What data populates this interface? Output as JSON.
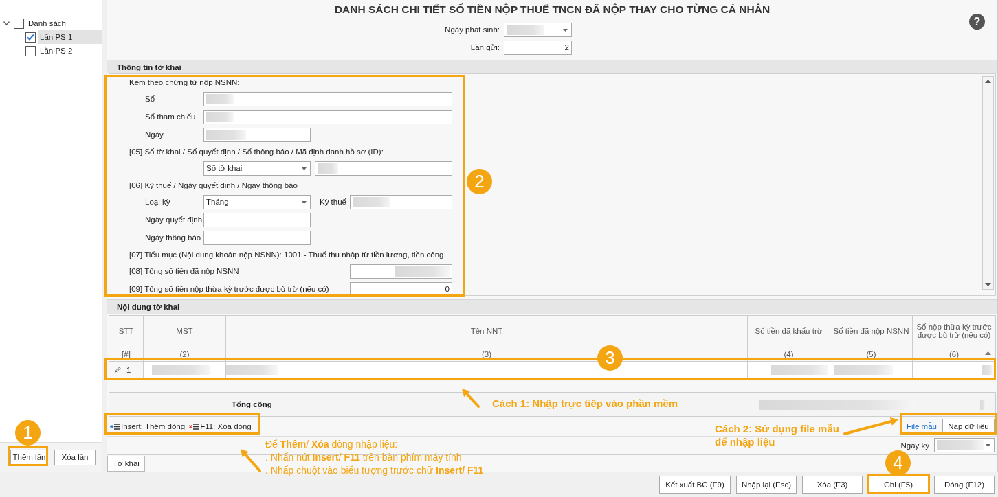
{
  "sidebar": {
    "tree": [
      {
        "label": "Danh sách",
        "checked": false,
        "expanded": true,
        "selected": false,
        "children": [
          {
            "label": "Lần PS 1",
            "checked": true,
            "selected": true
          },
          {
            "label": "Lần PS 2",
            "checked": false,
            "selected": false
          }
        ]
      }
    ],
    "buttons": [
      "Thêm lần",
      "Xóa lần"
    ]
  },
  "title": "DANH SÁCH CHI TIẾT SỐ TIỀN NỘP THUẾ TNCN ĐÃ NỘP THAY CHO TỪNG CÁ NHÂN",
  "help_button": "?",
  "header_fields": [
    {
      "label": "Ngày phát sinh:",
      "kind": "dropdown",
      "redacted": true
    },
    {
      "label": "Lần gửi:",
      "kind": "number",
      "value": "2"
    }
  ],
  "info_section": {
    "title": "Thông tin tờ khai",
    "rows": [
      {
        "kind": "heading",
        "label": "Kèm theo chứng từ nộp NSNN:"
      },
      {
        "kind": "text",
        "label": "Số",
        "redacted": true
      },
      {
        "kind": "text",
        "label": "Số tham chiếu",
        "redacted": true
      },
      {
        "kind": "date",
        "label": "Ngày",
        "redacted": true
      },
      {
        "kind": "heading",
        "label": "[05] Số tờ khai / Số quyết định / Số thông báo / Mã định danh hồ sơ (ID):"
      },
      {
        "kind": "select_text",
        "select": "Số tờ khai",
        "redacted": true
      },
      {
        "kind": "heading",
        "label": "[06] Kỳ thuế / Ngày quyết định / Ngày thông báo"
      },
      {
        "kind": "select_period",
        "label": "Loại kỳ",
        "select": "Tháng",
        "label2": "Kỳ thuế",
        "redacted": true
      },
      {
        "kind": "date",
        "label": "Ngày quyết định",
        "redacted": false
      },
      {
        "kind": "date",
        "label": "Ngày thông báo",
        "redacted": false
      },
      {
        "kind": "heading",
        "label": "[07] Tiểu mục (Nội dung khoản nộp NSNN): 1001 - Thuế thu nhập từ tiền lương, tiền công"
      },
      {
        "kind": "amount",
        "label": "[08] Tổng số tiền đã nộp NSNN",
        "redacted": true
      },
      {
        "kind": "amount",
        "label": "[09] Tổng số tiền nộp thừa kỳ trước được bù trừ (nếu có)",
        "value": "0",
        "redacted": false
      }
    ]
  },
  "content_section": {
    "title": "Nội dung tờ khai",
    "columns": [
      {
        "label": "STT",
        "number": "[#]"
      },
      {
        "label": "MST",
        "number": "(2)"
      },
      {
        "label": "Tên NNT",
        "number": "(3)"
      },
      {
        "label": "Số tiền đã khấu trừ",
        "number": "(4)"
      },
      {
        "label": "Số tiền đã nộp NSNN",
        "number": "(5)"
      },
      {
        "label": "Số nộp thừa kỳ trước được bù trừ (nếu có)",
        "number": "(6)"
      }
    ],
    "rows": [
      {
        "stt": "1",
        "editing": true,
        "cells": [
          {
            "redacted": true
          },
          {
            "redacted": true
          },
          {
            "redacted": true
          },
          {
            "redacted": true
          },
          {
            "redacted": true
          }
        ]
      }
    ],
    "total": {
      "label": "Tổng cộng",
      "redacted": true
    },
    "toolbar": [
      {
        "kind": "insert",
        "label": "Insert: Thêm dòng"
      },
      {
        "kind": "delete",
        "label": "F11: Xóa dòng"
      }
    ],
    "template_link": "File mẫu",
    "load_button": "Nạp dữ liệu",
    "sign_date": {
      "label": "Ngày ký",
      "redacted": true
    }
  },
  "tabs": [
    {
      "label": "Tờ khai",
      "selected": true
    }
  ],
  "footer_buttons": [
    "Kết xuất BC (F9)",
    "Nhập lại (Esc)",
    "Xóa (F3)",
    "Ghi (F5)",
    "Đóng (F12)"
  ],
  "annotations": {
    "badges": [
      "1",
      "2",
      "3",
      "4"
    ],
    "notes": [
      {
        "kind": "single",
        "lines": [
          "Cách 1: Nhập trực tiếp vào phần mềm"
        ]
      },
      {
        "kind": "single",
        "lines": [
          "Cách 2: Sử dụng file mẫu",
          "để nhập liệu"
        ]
      },
      {
        "kind": "detail",
        "lines": [
          "Để **Thêm**/ **Xóa** dòng nhập liệu:",
          ". Nhấn nút **Insert**/ **F11** trên bàn phím máy tính",
          ". Nhấp chuột vào biểu tượng trước chữ **Insert/ F11**"
        ]
      }
    ]
  }
}
